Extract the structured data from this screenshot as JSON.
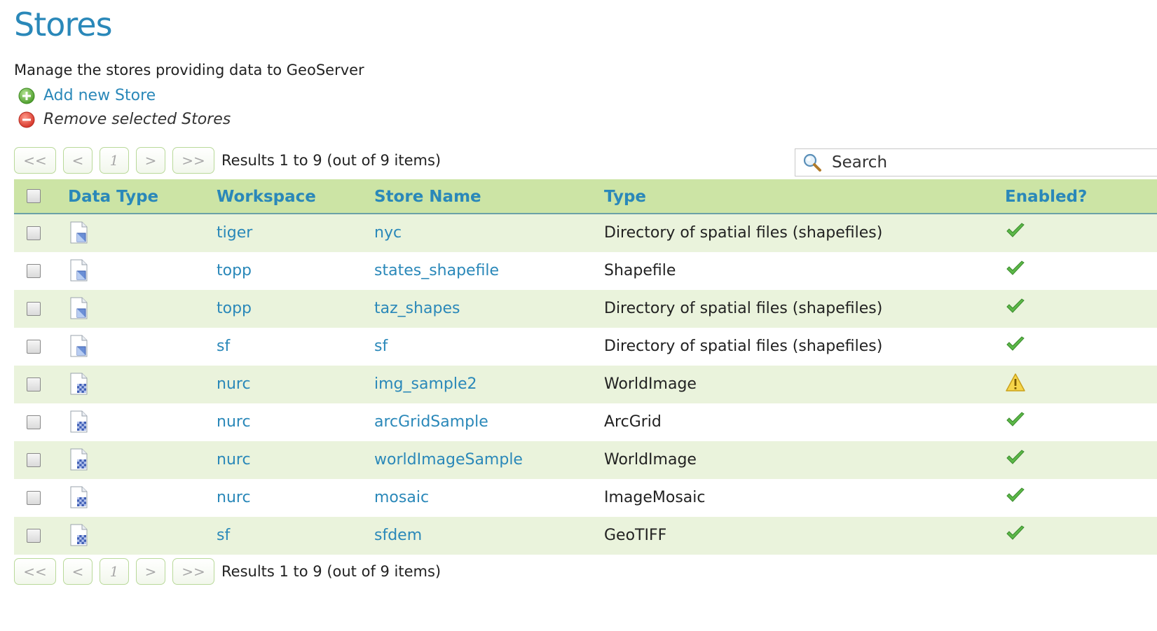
{
  "page": {
    "title": "Stores",
    "description": "Manage the stores providing data to GeoServer"
  },
  "actions": {
    "add_label": "Add new Store",
    "remove_label": "Remove selected Stores"
  },
  "pager": {
    "first": "<<",
    "prev": "<",
    "current": "1",
    "next": ">",
    "last": ">>",
    "results": "Results 1 to 9 (out of 9 items)"
  },
  "search": {
    "placeholder": "Search"
  },
  "table": {
    "headers": {
      "data_type": "Data Type",
      "workspace": "Workspace",
      "store_name": "Store Name",
      "type": "Type",
      "enabled": "Enabled?"
    },
    "rows": [
      {
        "data_type": "vector",
        "workspace": "tiger",
        "store_name": "nyc",
        "type": "Directory of spatial files (shapefiles)",
        "enabled": "check"
      },
      {
        "data_type": "vector",
        "workspace": "topp",
        "store_name": "states_shapefile",
        "type": "Shapefile",
        "enabled": "check"
      },
      {
        "data_type": "vector",
        "workspace": "topp",
        "store_name": "taz_shapes",
        "type": "Directory of spatial files (shapefiles)",
        "enabled": "check"
      },
      {
        "data_type": "vector",
        "workspace": "sf",
        "store_name": "sf",
        "type": "Directory of spatial files (shapefiles)",
        "enabled": "check"
      },
      {
        "data_type": "raster",
        "workspace": "nurc",
        "store_name": "img_sample2",
        "type": "WorldImage",
        "enabled": "warning"
      },
      {
        "data_type": "raster",
        "workspace": "nurc",
        "store_name": "arcGridSample",
        "type": "ArcGrid",
        "enabled": "check"
      },
      {
        "data_type": "raster",
        "workspace": "nurc",
        "store_name": "worldImageSample",
        "type": "WorldImage",
        "enabled": "check"
      },
      {
        "data_type": "raster",
        "workspace": "nurc",
        "store_name": "mosaic",
        "type": "ImageMosaic",
        "enabled": "check"
      },
      {
        "data_type": "raster",
        "workspace": "sf",
        "store_name": "sfdem",
        "type": "GeoTIFF",
        "enabled": "check"
      }
    ]
  },
  "colors": {
    "accent": "#2a88b9",
    "header_bg": "#cce4a5",
    "row_alt": "#eaf3dc",
    "check": "#4caf50",
    "warning": "#f0c419"
  },
  "icons": {
    "add": "plus-circle-icon",
    "remove": "minus-circle-icon",
    "search": "magnifier-icon",
    "vector": "vector-file-icon",
    "raster": "raster-file-icon",
    "enabled": "check-icon",
    "disabled_warning": "warning-icon"
  }
}
